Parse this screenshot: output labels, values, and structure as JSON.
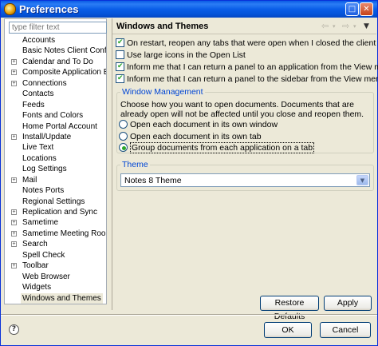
{
  "window": {
    "title": "Preferences"
  },
  "titlebar": {
    "maximize_glyph": "□",
    "close_glyph": "✕"
  },
  "sidebar": {
    "filter_placeholder": "type filter text",
    "items": [
      {
        "label": "Accounts",
        "expandable": false
      },
      {
        "label": "Basic Notes Client Configura",
        "expandable": false
      },
      {
        "label": "Calendar and To Do",
        "expandable": true
      },
      {
        "label": "Composite Application Edit",
        "expandable": true
      },
      {
        "label": "Connections",
        "expandable": true
      },
      {
        "label": "Contacts",
        "expandable": false
      },
      {
        "label": "Feeds",
        "expandable": false
      },
      {
        "label": "Fonts and Colors",
        "expandable": false
      },
      {
        "label": "Home Portal Account",
        "expandable": false
      },
      {
        "label": "Install/Update",
        "expandable": true
      },
      {
        "label": "Live Text",
        "expandable": false
      },
      {
        "label": "Locations",
        "expandable": false
      },
      {
        "label": "Log Settings",
        "expandable": false
      },
      {
        "label": "Mail",
        "expandable": true
      },
      {
        "label": "Notes Ports",
        "expandable": false
      },
      {
        "label": "Regional Settings",
        "expandable": false
      },
      {
        "label": "Replication and Sync",
        "expandable": true
      },
      {
        "label": "Sametime",
        "expandable": true
      },
      {
        "label": "Sametime Meeting Rooms",
        "expandable": true
      },
      {
        "label": "Search",
        "expandable": true
      },
      {
        "label": "Spell Check",
        "expandable": false
      },
      {
        "label": "Toolbar",
        "expandable": true
      },
      {
        "label": "Web Browser",
        "expandable": false
      },
      {
        "label": "Widgets",
        "expandable": false
      },
      {
        "label": "Windows and Themes",
        "expandable": false,
        "selected": true
      }
    ]
  },
  "main": {
    "title": "Windows and Themes",
    "nav": {
      "back": "⇦",
      "forward": "⇨",
      "dropdown": "▾",
      "menu": "▼"
    },
    "options": [
      {
        "label": "On restart, reopen any tabs that were open when I closed the client",
        "checked": true
      },
      {
        "label": "Use large icons in the Open List",
        "checked": false
      },
      {
        "label": "Inform me that I can return a panel to an application from the View menu",
        "checked": true
      },
      {
        "label": "Inform me that I can return a panel to the sidebar from the View menu",
        "checked": true
      }
    ],
    "window_management": {
      "title": "Window Management",
      "description": "Choose how you want to open documents.  Documents that are already open will not be affected until you close and reopen them.",
      "radios": [
        {
          "label": "Open each document in its own window",
          "selected": false
        },
        {
          "label": "Open each document in its own tab",
          "selected": false
        },
        {
          "label": "Group documents from each application on a tab",
          "selected": true
        }
      ]
    },
    "theme": {
      "title": "Theme",
      "selected": "Notes 8 Theme",
      "dropdown_glyph": "▼"
    },
    "restore_defaults_label": "Restore Defaults",
    "apply_label": "Apply"
  },
  "footer": {
    "help_glyph": "?",
    "ok_label": "OK",
    "cancel_label": "Cancel"
  }
}
